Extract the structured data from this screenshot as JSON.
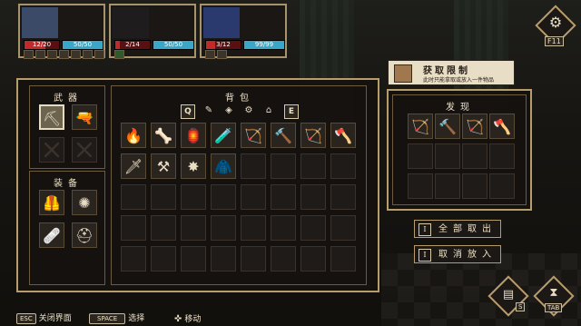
{
  "party": [
    {
      "hp": "12/20",
      "hp_frac": 0.6,
      "mp": "50/50",
      "mp_frac": 1.0,
      "slot_nums": [
        "8",
        "",
        "2",
        "",
        "",
        "3"
      ]
    },
    {
      "hp": "2/14",
      "hp_frac": 0.14,
      "mp": "50/50",
      "mp_frac": 1.0,
      "slot_nums": [
        "",
        "",
        "",
        "",
        "",
        ""
      ]
    },
    {
      "hp": "3/12",
      "hp_frac": 0.25,
      "mp": "99/99",
      "mp_frac": 1.0,
      "slot_nums": [
        "",
        "",
        "",
        "",
        "",
        ""
      ]
    }
  ],
  "settings": {
    "key": "F11"
  },
  "weapons": {
    "title": "武器"
  },
  "equipment": {
    "title": "装备"
  },
  "backpack": {
    "title": "背包",
    "keys": {
      "left": "Q",
      "right": "E"
    }
  },
  "discover": {
    "title": "发现"
  },
  "tooltip": {
    "title": "获取限制",
    "desc": "此时只能拿取或放入一件物品"
  },
  "buttons": {
    "take_all": {
      "key": "I",
      "label": "全部取出"
    },
    "cancel_put": {
      "key": "I",
      "label": "取消放入"
    }
  },
  "footer": {
    "esc": {
      "key": "ESC",
      "label": "关闭界面"
    },
    "space": {
      "key": "SPACE",
      "label": "选择"
    },
    "move": {
      "label": "移动"
    }
  },
  "corner": {
    "key_s": "S",
    "key_tab": "TAB"
  },
  "backpack_items": [
    "torch-icon",
    "bones-icon",
    "lantern-icon",
    "potion-icon",
    "bow-icon",
    "hammer-icon",
    "bow-icon",
    "axe-icon",
    "sword-icon",
    "pickaxe-icon",
    "spike-icon",
    "cloak-icon"
  ],
  "discover_items": [
    "bow-icon",
    "hammer-icon",
    "bow-icon",
    "axe-icon"
  ],
  "colors": {
    "frame": "#b89d6c",
    "hp": "#c22a2a",
    "mp": "#3aa7c9",
    "panel": "#14110f"
  }
}
